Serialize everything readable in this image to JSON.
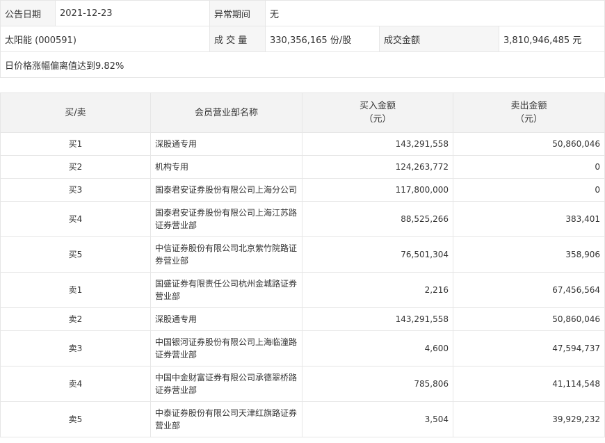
{
  "summary": {
    "date_label": "公告日期",
    "date_value": "2021-12-23",
    "period_label": "异常期间",
    "period_value": "无",
    "stock_name": "太阳能 (000591)",
    "volume_label": "成 交 量",
    "volume_value": "330,356,165 份/股",
    "amount_label": "成交金额",
    "amount_value": "3,810,946,485 元",
    "reason": "日价格涨幅偏离值达到9.82%"
  },
  "table": {
    "headers": {
      "side": "买/卖",
      "branch": "会员营业部名称",
      "buy_line1": "买入金额",
      "buy_line2": "（元）",
      "sell_line1": "卖出金额",
      "sell_line2": "（元）"
    },
    "rows": [
      {
        "side": "买1",
        "branch": "深股通专用",
        "buy": "143,291,558",
        "sell": "50,860,046"
      },
      {
        "side": "买2",
        "branch": "机构专用",
        "buy": "124,263,772",
        "sell": "0"
      },
      {
        "side": "买3",
        "branch": "国泰君安证券股份有限公司上海分公司",
        "buy": "117,800,000",
        "sell": "0"
      },
      {
        "side": "买4",
        "branch": "国泰君安证券股份有限公司上海江苏路证券营业部",
        "buy": "88,525,266",
        "sell": "383,401"
      },
      {
        "side": "买5",
        "branch": "中信证券股份有限公司北京紫竹院路证券营业部",
        "buy": "76,501,304",
        "sell": "358,906"
      },
      {
        "side": "卖1",
        "branch": "国盛证券有限责任公司杭州金城路证券营业部",
        "buy": "2,216",
        "sell": "67,456,564"
      },
      {
        "side": "卖2",
        "branch": "深股通专用",
        "buy": "143,291,558",
        "sell": "50,860,046"
      },
      {
        "side": "卖3",
        "branch": "中国银河证券股份有限公司上海临潼路证券营业部",
        "buy": "4,600",
        "sell": "47,594,737"
      },
      {
        "side": "卖4",
        "branch": "中国中金财富证券有限公司承德翠桥路证券营业部",
        "buy": "785,806",
        "sell": "41,114,548"
      },
      {
        "side": "卖5",
        "branch": "中泰证券股份有限公司天津红旗路证券营业部",
        "buy": "3,504",
        "sell": "39,929,232"
      }
    ]
  }
}
